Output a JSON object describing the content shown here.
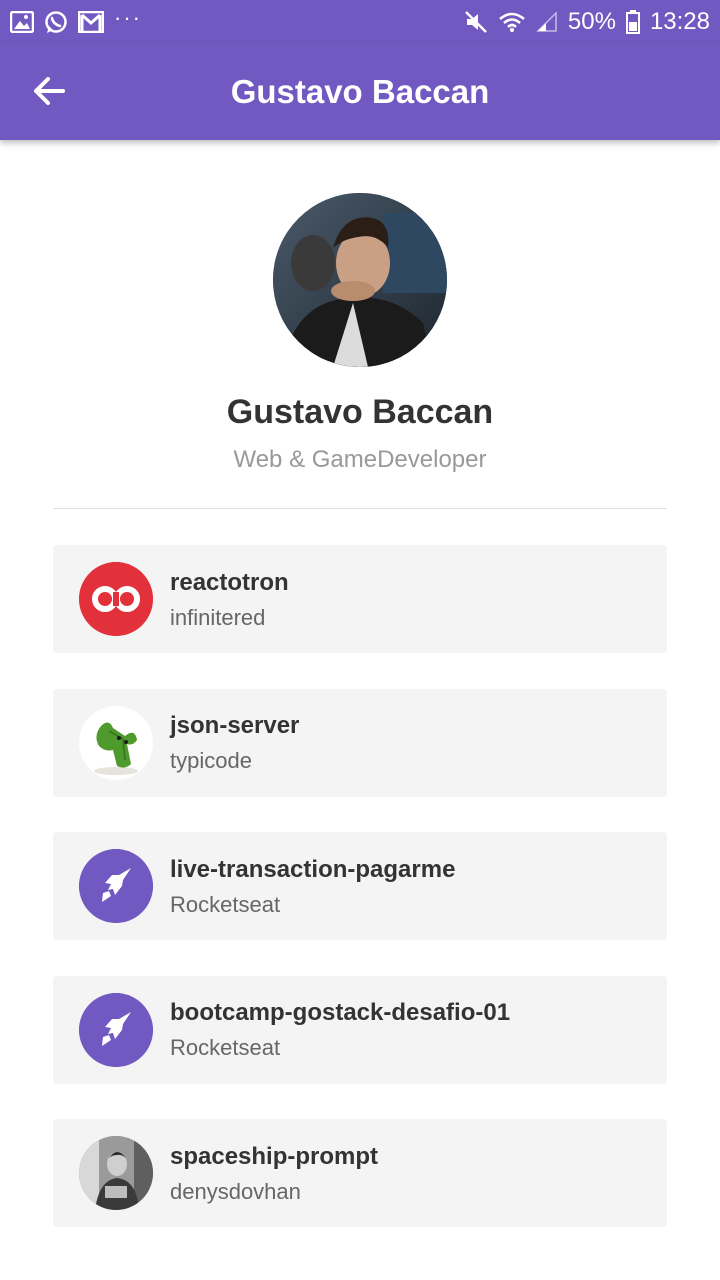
{
  "status_bar": {
    "battery": "50%",
    "time": "13:28",
    "dots": "···",
    "left_icons": [
      "gallery-icon",
      "whatsapp-icon",
      "gmail-icon"
    ],
    "right_icons": [
      "mute-icon",
      "wifi-icon",
      "signal-icon",
      "battery-icon"
    ]
  },
  "app_bar": {
    "title": "Gustavo Baccan",
    "back_icon": "arrow-left-icon"
  },
  "profile": {
    "name": "Gustavo Baccan",
    "bio": "Web & GameDeveloper"
  },
  "colors": {
    "primary": "#7159c1",
    "card_bg": "#f4f4f4",
    "title_text": "#333333",
    "subtitle_text": "#999999",
    "reactotron_red": "#e2313a"
  },
  "starred": [
    {
      "title": "reactotron",
      "owner": "infinitered",
      "avatar_icon": "infinitered-logo-icon"
    },
    {
      "title": "json-server",
      "owner": "typicode",
      "avatar_icon": "cactus-icon"
    },
    {
      "title": "live-transaction-pagarme",
      "owner": "Rocketseat",
      "avatar_icon": "rocketseat-logo-icon"
    },
    {
      "title": "bootcamp-gostack-desafio-01",
      "owner": "Rocketseat",
      "avatar_icon": "rocketseat-logo-icon"
    },
    {
      "title": "spaceship-prompt",
      "owner": "denysdovhan",
      "avatar_icon": "user-photo-icon"
    }
  ]
}
